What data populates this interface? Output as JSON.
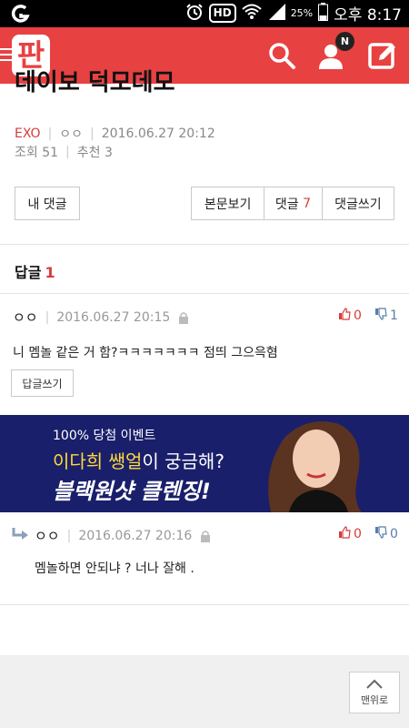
{
  "status_bar": {
    "battery_pct": "25%",
    "hd_label": "HD",
    "time": "오후 8:17"
  },
  "app_bar": {
    "logo_text": "판",
    "notification_badge": "N",
    "accent_color": "#e84142"
  },
  "article": {
    "title_fragment": "데이보 덕모데모",
    "category": "EXO",
    "author": "ㅇㅇ",
    "datetime": "2016.06.27 20:12",
    "views_label": "조회 51",
    "recommend_label": "추천 3"
  },
  "actions": {
    "my_comments": "내 댓글",
    "view_article": "본문보기",
    "comments_label": "댓글",
    "comments_count": "7",
    "write_comment": "댓글쓰기"
  },
  "replies": {
    "header_label": "답글",
    "header_count": "1"
  },
  "comments": [
    {
      "author": "ㅇㅇ",
      "datetime": "2016.06.27 20:15",
      "upvotes": "0",
      "downvotes": "1",
      "text": "니 멤놀 같은 거 함?ㅋㅋㅋㅋㅋㅋㅋ 점띄 그으윽혐",
      "reply_button": "답글쓰기"
    },
    {
      "author": "ㅇㅇ",
      "datetime": "2016.06.27 20:16",
      "upvotes": "0",
      "downvotes": "0",
      "text": "멤놀하면 안되냐 ? 너나 잘해 ."
    }
  ],
  "banner": {
    "line1": "100% 당첨 이벤트",
    "line2_highlight": "이다희 쌩얼",
    "line2_rest": "이 궁금해?",
    "line3": "블랙원샷 클렌징!"
  },
  "top_button": "맨위로"
}
